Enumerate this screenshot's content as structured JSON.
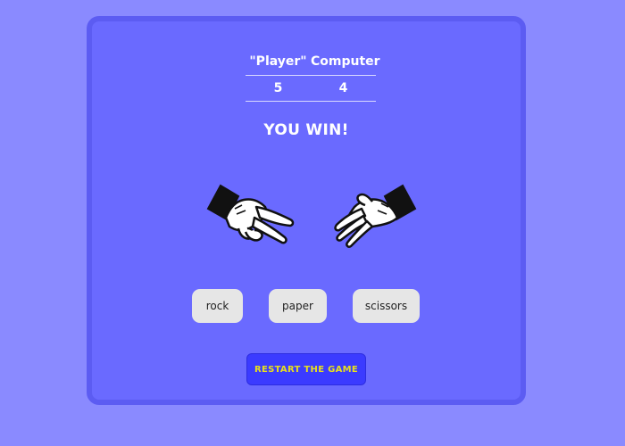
{
  "scoreboard": {
    "player_label": "\"Player\"",
    "computer_label": "Computer",
    "player_score": "5",
    "computer_score": "4"
  },
  "result_text": "YOU WIN!",
  "hands": {
    "player_hand_icon": "scissors-hand-icon",
    "computer_hand_icon": "paper-hand-icon"
  },
  "choices": {
    "rock": "rock",
    "paper": "paper",
    "scissors": "scissors"
  },
  "restart_label": "RESTART THE GAME",
  "colors": {
    "background": "#8a8aff",
    "card": "#6a6aff",
    "restart_button": "#3b3bff",
    "restart_text": "#e8e01c"
  }
}
